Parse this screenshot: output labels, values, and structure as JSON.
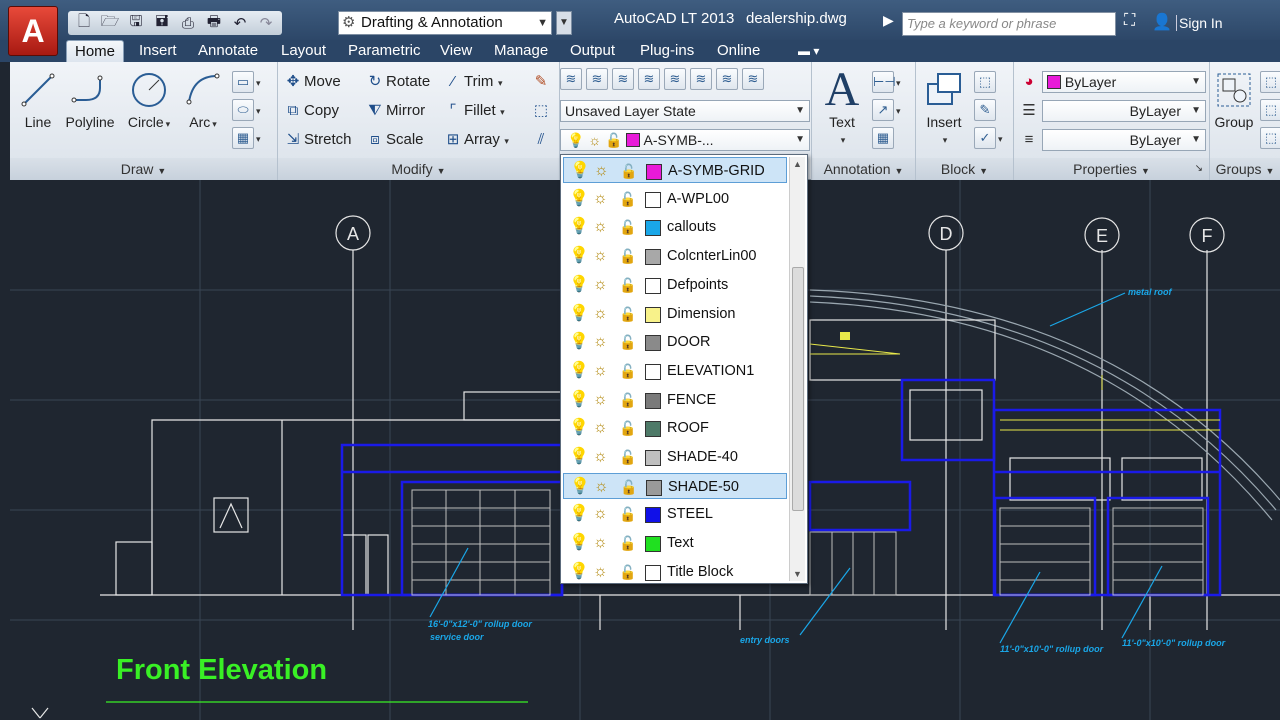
{
  "title_bar": {
    "app_logo": "A",
    "workspace": "Drafting & Annotation",
    "app_title": "AutoCAD LT 2013",
    "document": "dealership.dwg",
    "search_placeholder": "Type a keyword or phrase",
    "sign_in": "Sign In"
  },
  "tabs": [
    "Home",
    "Insert",
    "Annotate",
    "Layout",
    "Parametric",
    "View",
    "Manage",
    "Output",
    "Plug-ins",
    "Online"
  ],
  "ribbon": {
    "draw": {
      "title": "Draw",
      "line": "Line",
      "polyline": "Polyline",
      "circle": "Circle",
      "arc": "Arc"
    },
    "modify": {
      "title": "Modify",
      "move": "Move",
      "rotate": "Rotate",
      "trim": "Trim",
      "copy": "Copy",
      "mirror": "Mirror",
      "fillet": "Fillet",
      "stretch": "Stretch",
      "scale": "Scale",
      "array": "Array"
    },
    "layers": {
      "layer_state": "Unsaved Layer State",
      "current_layer": "A-SYMB-...",
      "current_color": "#e81ad8"
    },
    "annotation": {
      "title": "Annotation",
      "text": "Text"
    },
    "block": {
      "title": "Block",
      "insert": "Insert"
    },
    "properties": {
      "title": "Properties",
      "color": "ByLayer",
      "color_swatch": "#e81ad8",
      "linetype": "ByLayer",
      "lineweight": "ByLayer"
    },
    "groups": {
      "title": "Groups",
      "group": "Group"
    }
  },
  "layers": [
    {
      "name": "A-SYMB-GRID",
      "color": "#e81ad8",
      "selected": true
    },
    {
      "name": "A-WPL00",
      "color": "#ffffff"
    },
    {
      "name": "callouts",
      "color": "#1aa7e8"
    },
    {
      "name": "ColcnterLin00",
      "color": "#a8a8a8"
    },
    {
      "name": "Defpoints",
      "color": "#ffffff"
    },
    {
      "name": "Dimension",
      "color": "#f8f28a"
    },
    {
      "name": "DOOR",
      "color": "#8a8a8a"
    },
    {
      "name": "ELEVATION1",
      "color": "#ffffff"
    },
    {
      "name": "FENCE",
      "color": "#7a7a7a"
    },
    {
      "name": "ROOF",
      "color": "#4e7a68"
    },
    {
      "name": "SHADE-40",
      "color": "#bfbfbf"
    },
    {
      "name": "SHADE-50",
      "color": "#9a9a9a",
      "selected": true
    },
    {
      "name": "STEEL",
      "color": "#1010e8"
    },
    {
      "name": "Text",
      "color": "#20e020"
    },
    {
      "name": "Title Block",
      "color": "#ffffff"
    }
  ],
  "drawing": {
    "grid_labels": [
      "A",
      "D",
      "E",
      "F"
    ],
    "annotations": {
      "roof": "metal roof",
      "rollup1": "16'-0\"x12'-0\" rollup door",
      "service": "service door",
      "entry": "entry doors",
      "rollup2": "11'-0\"x10'-0\" rollup door",
      "rollup3": "11'-0\"x10'-0\" rollup door"
    },
    "title": "Front Elevation"
  }
}
